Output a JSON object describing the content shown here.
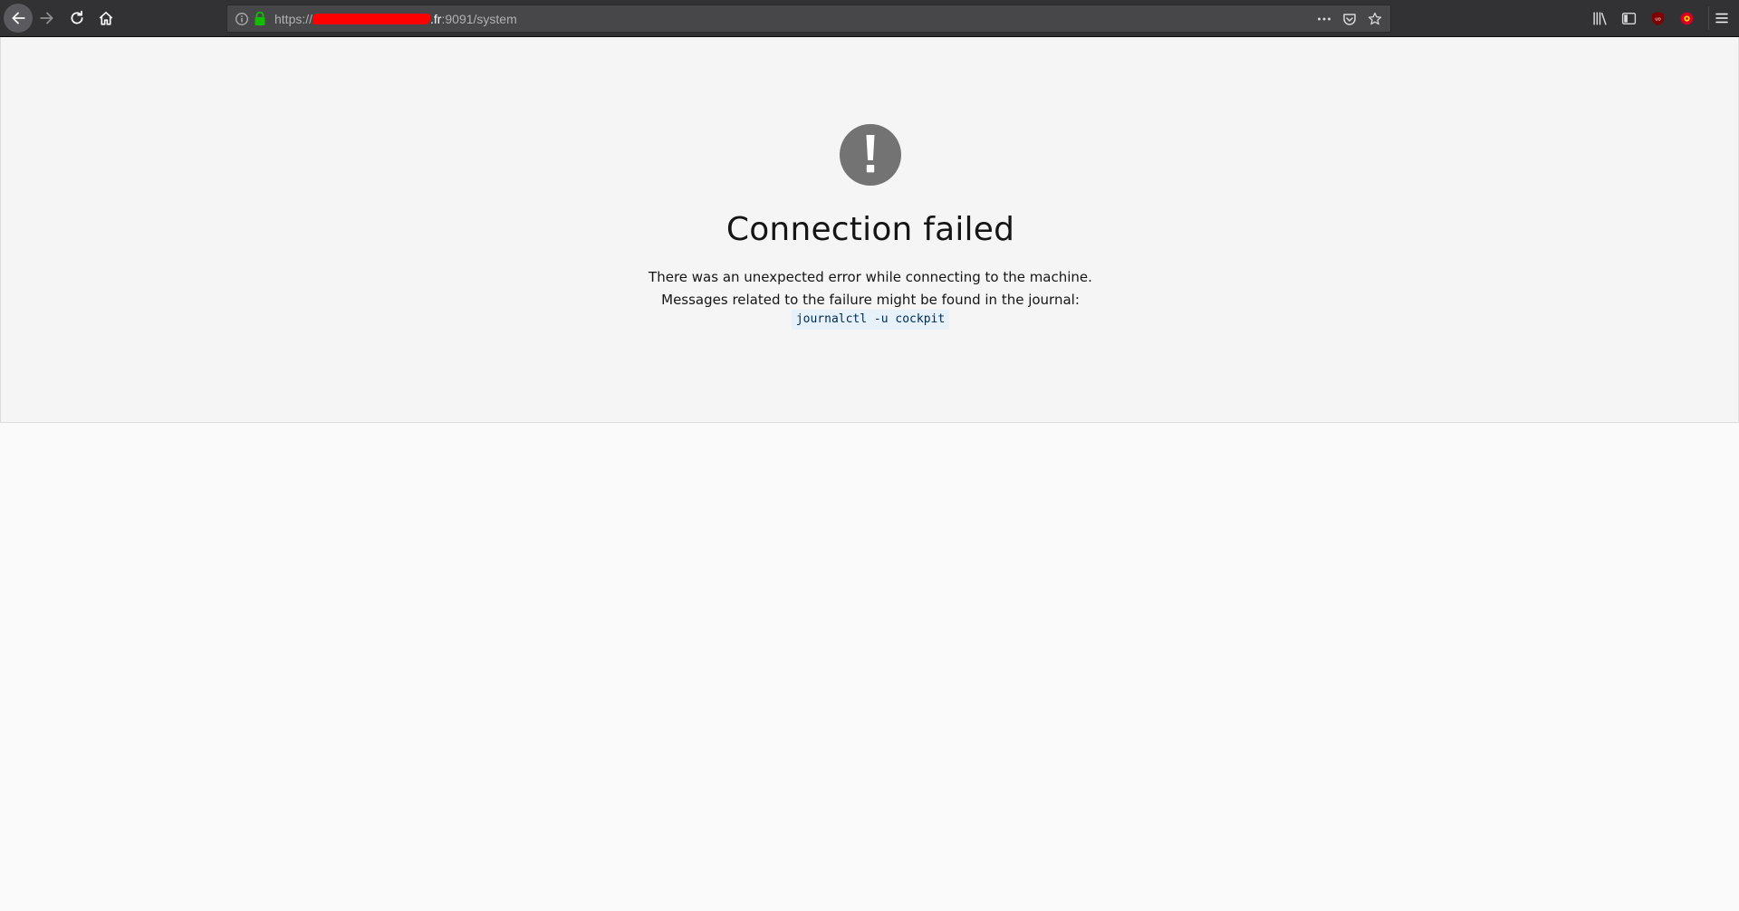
{
  "browser": {
    "url": {
      "scheme": "https://",
      "host_suffix": ".fr",
      "port_path": ":9091/system"
    },
    "icons": {
      "back": "arrow-left-icon",
      "forward": "arrow-right-icon",
      "reload": "reload-icon",
      "home": "home-icon",
      "site_info": "info-icon",
      "secure": "lock-icon",
      "page_actions": "more-icon",
      "pocket": "pocket-icon",
      "bookmark": "star-icon",
      "library": "library-icon",
      "sidebar": "sidebar-icon",
      "extension_1": "ublock-icon",
      "extension_2": "extension-icon",
      "menu": "hamburger-menu-icon"
    },
    "colors": {
      "toolbar": "#323234",
      "urlbar": "#474749",
      "lock": "#12bc00",
      "redaction": "#ff0000"
    }
  },
  "error": {
    "title": "Connection failed",
    "line1": "There was an unexpected error while connecting to the machine.",
    "line2": "Messages related to the failure might be found in the journal:",
    "command": "journalctl -u cockpit",
    "icon": "exclamation-circle-icon",
    "icon_color": "#737373"
  }
}
